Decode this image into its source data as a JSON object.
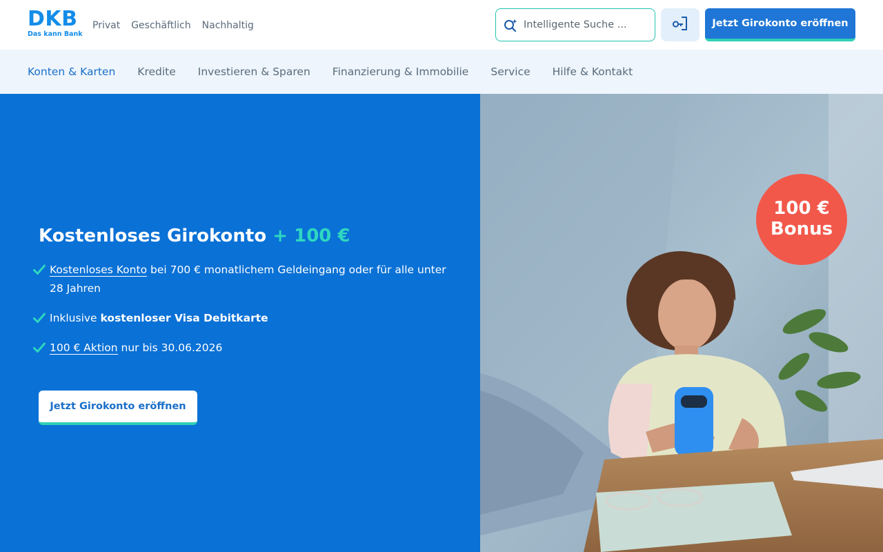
{
  "brand": {
    "logo_text": "DKB",
    "claim": "Das kann Bank",
    "primary_color": "#1f76d6",
    "accent_color": "#2fd0b5",
    "bonus_color": "#f2584a"
  },
  "header": {
    "segments": [
      "Privat",
      "Geschäftlich",
      "Nachhaltig"
    ],
    "search_placeholder": "Intelligente Suche ...",
    "search_icon": "sparkle-search-icon",
    "login_icon": "login-icon",
    "cta_label": "Jetzt Girokonto eröffnen"
  },
  "nav": {
    "items": [
      "Konten & Karten",
      "Kredite",
      "Investieren & Sparen",
      "Finanzierung & Immobilie",
      "Service",
      "Hilfe & Kontakt"
    ],
    "active": "Konten & Karten"
  },
  "hero": {
    "title_main": "Kostenloses Girokonto",
    "title_accent": "+ 100 €",
    "benefits": [
      {
        "link": "Kostenloses Konto",
        "text": " bei 700 € monatlichem Geldeingang oder für alle unter 28 Jahren"
      },
      {
        "prefix": "Inklusive ",
        "bold": "kostenloser Visa Debitkarte"
      },
      {
        "link": "100 € Aktion",
        "text": " nur bis 30.06.2026"
      }
    ],
    "check_icon": "check-icon",
    "cta_label": "Jetzt Girokonto eröffnen"
  },
  "badge": {
    "amount": "100 €",
    "label": "Bonus"
  }
}
